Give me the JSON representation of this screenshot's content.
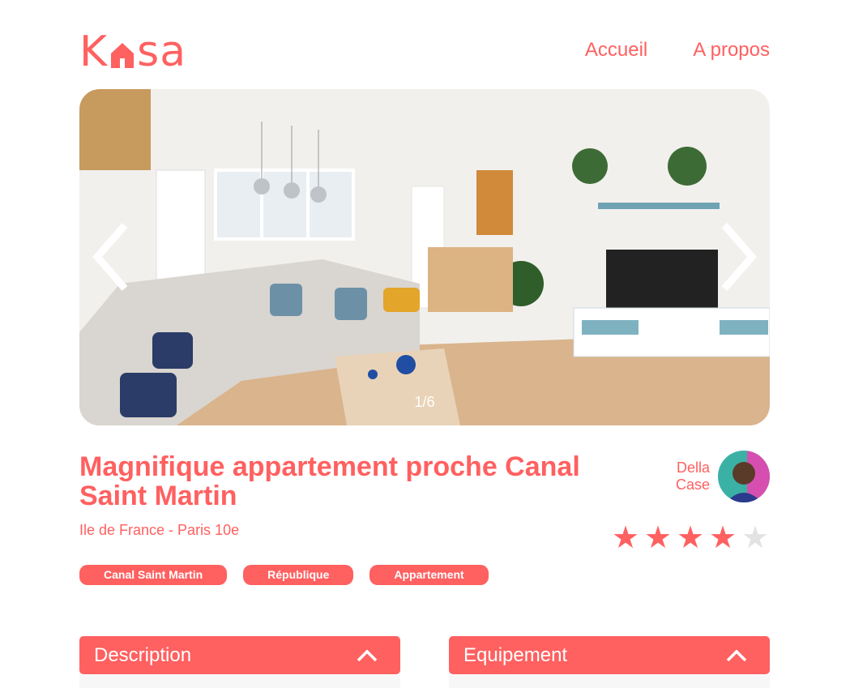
{
  "brand": {
    "logo_left": "K",
    "logo_right": "sa",
    "color": "#FF6060"
  },
  "nav": {
    "home": "Accueil",
    "about": "A propos"
  },
  "gallery": {
    "counter": "1/6",
    "prev_icon": "chevron-left-icon",
    "next_icon": "chevron-right-icon"
  },
  "listing": {
    "title": "Magnifique appartement proche Canal Saint Martin",
    "location": "Ile de France - Paris 10e",
    "tags": [
      "Canal Saint Martin",
      "République",
      "Appartement"
    ],
    "rating": 4,
    "rating_max": 5
  },
  "host": {
    "first_name": "Della",
    "last_name": "Case"
  },
  "sections": {
    "description": {
      "label": "Description",
      "icon": "chevron-up-icon"
    },
    "equipment": {
      "label": "Equipement",
      "icon": "chevron-up-icon"
    }
  }
}
